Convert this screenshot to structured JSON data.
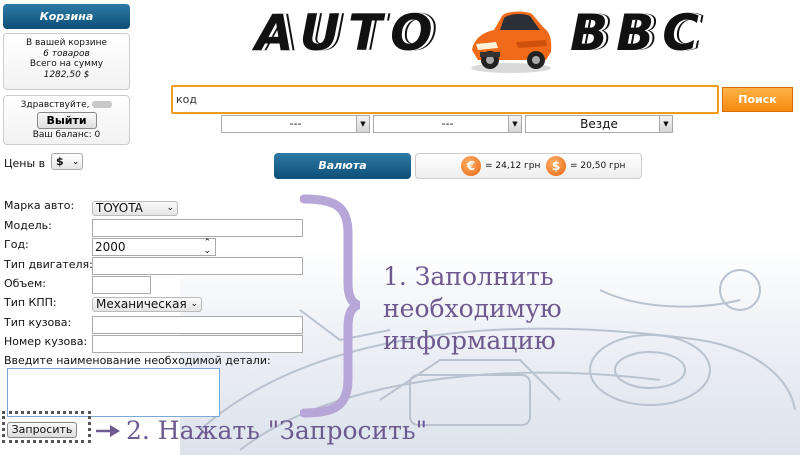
{
  "sidebar": {
    "cart_title": "Корзина",
    "cart_line1": "В вашей корзине",
    "cart_line2": "6 товаров",
    "cart_line3": "Всего на сумму",
    "cart_line4": "1282,50 $",
    "greeting": "Здравствуйте,",
    "logout_label": "Выйти",
    "balance": "Ваш баланс: 0",
    "prices_label": "Цены в",
    "currency_value": "$"
  },
  "logo": {
    "left": "AUTO",
    "right": "BBC"
  },
  "search": {
    "value": "код",
    "button_label": "Поиск",
    "select1": "---",
    "select2": "---",
    "select3": "Везде"
  },
  "currency": {
    "title": "Валюта",
    "eur_symbol": "€",
    "eur_rate": "= 24,12 грн",
    "usd_symbol": "$",
    "usd_rate": "= 20,50 грн"
  },
  "form": {
    "brand_label": "Марка авто:",
    "brand_value": "TOYOTA",
    "model_label": "Модель:",
    "model_value": "",
    "year_label": "Год:",
    "year_value": "2000",
    "engine_label": "Тип двигателя:",
    "engine_value": "",
    "volume_label": "Объем:",
    "volume_value": "",
    "gearbox_label": "Тип КПП:",
    "gearbox_value": "Механическая",
    "body_label": "Тип кузова:",
    "body_value": "",
    "body_number_label": "Номер кузова:",
    "body_number_value": "",
    "part_label": "Введите наименование необходимой детали:",
    "part_value": "",
    "submit_label": "Запросить"
  },
  "annotations": {
    "step1_line1": "1. Заполнить",
    "step1_line2": "необходимую",
    "step1_line3": "информацию",
    "step2": "2. Нажать \"Запросить\"",
    "color": "#6c5a90"
  },
  "colors": {
    "accent_orange": "#f58a10",
    "header_blue": "#0d4f77",
    "brace_purple": "#b7a6d8"
  }
}
